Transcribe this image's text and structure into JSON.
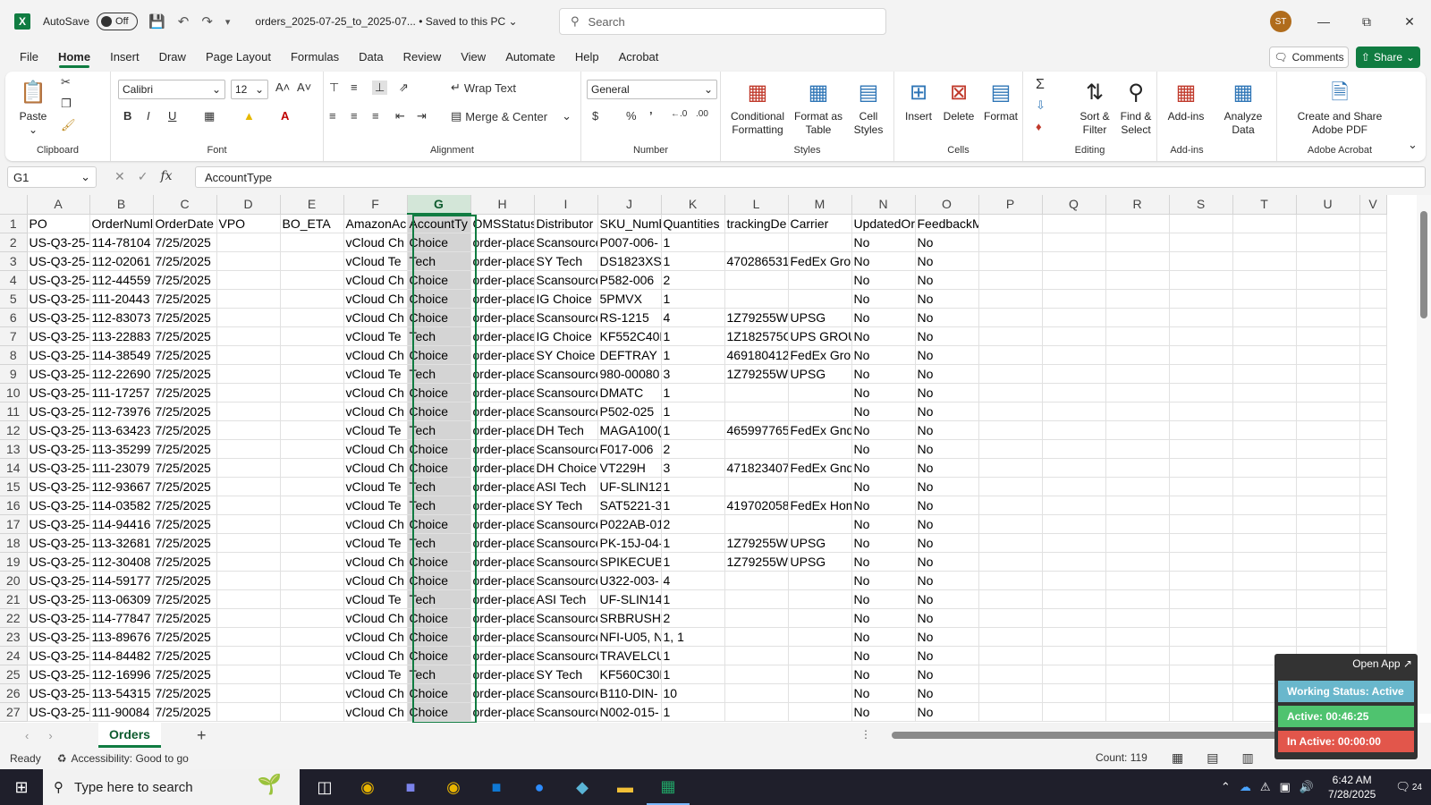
{
  "titlebar": {
    "autosave_label": "AutoSave",
    "autosave_state": "Off",
    "doc_name": "orders_2025-07-25_to_2025-07...",
    "save_state": "Saved to this PC",
    "search_placeholder": "Search",
    "user_initials": "ST"
  },
  "menu": {
    "tabs": [
      "File",
      "Home",
      "Insert",
      "Draw",
      "Page Layout",
      "Formulas",
      "Data",
      "Review",
      "View",
      "Automate",
      "Help",
      "Acrobat"
    ],
    "active": "Home",
    "comments": "Comments",
    "share": "Share"
  },
  "ribbon": {
    "clipboard": {
      "label": "Clipboard",
      "paste": "Paste"
    },
    "font": {
      "label": "Font",
      "font_name": "Calibri",
      "font_size": "12"
    },
    "alignment": {
      "label": "Alignment",
      "wrap": "Wrap Text",
      "merge": "Merge & Center"
    },
    "number": {
      "label": "Number",
      "format": "General"
    },
    "styles": {
      "label": "Styles",
      "cond1": "Conditional",
      "cond2": "Formatting",
      "fmt1": "Format as",
      "fmt2": "Table",
      "cell1": "Cell",
      "cell2": "Styles"
    },
    "cells": {
      "label": "Cells",
      "insert": "Insert",
      "delete": "Delete",
      "format": "Format"
    },
    "editing": {
      "label": "Editing",
      "sort1": "Sort &",
      "sort2": "Filter",
      "find1": "Find &",
      "find2": "Select"
    },
    "addins": {
      "label": "Add-ins",
      "addins": "Add-ins",
      "analyze1": "Analyze",
      "analyze2": "Data"
    },
    "acrobat": {
      "label": "Adobe Acrobat",
      "create1": "Create and Share",
      "create2": "Adobe PDF"
    }
  },
  "formula_bar": {
    "name_box": "G1",
    "formula": "AccountType"
  },
  "sheet": {
    "columns": [
      "A",
      "B",
      "C",
      "D",
      "E",
      "F",
      "G",
      "H",
      "I",
      "J",
      "K",
      "L",
      "M",
      "N",
      "O",
      "P",
      "Q",
      "R",
      "S",
      "T",
      "U",
      "V"
    ],
    "selected_column": "G",
    "rows": [
      [
        "PO",
        "OrderNuml",
        "OrderDate",
        "VPO",
        "BO_ETA",
        "AmazonAc",
        "AccountTy",
        "OMSStatus",
        "Distributor",
        "SKU_Numb",
        "Quantities",
        "trackingDe",
        "Carrier",
        "UpdatedOr",
        "FeedbackMessage"
      ],
      [
        "US-Q3-25-",
        "114-78104",
        "7/25/2025",
        "",
        "",
        "vCloud Ch",
        "Choice",
        "order-place",
        "Scansource",
        "P007-006-",
        "1",
        "",
        "",
        "No",
        "No"
      ],
      [
        "US-Q3-25-",
        "112-02061",
        "7/25/2025",
        "",
        "",
        "vCloud Te",
        "Tech",
        "order-place",
        "SY Tech",
        "DS1823XS+",
        "1",
        "470286531",
        "FedEx Grou",
        "No",
        "No"
      ],
      [
        "US-Q3-25-",
        "112-44559",
        "7/25/2025",
        "",
        "",
        "vCloud Ch",
        "Choice",
        "order-place",
        "Scansource",
        "P582-006",
        "2",
        "",
        "",
        "No",
        "No"
      ],
      [
        "US-Q3-25-",
        "111-20443",
        "7/25/2025",
        "",
        "",
        "vCloud Ch",
        "Choice",
        "order-place",
        "IG Choice",
        "5PMVX",
        "1",
        "",
        "",
        "No",
        "No"
      ],
      [
        "US-Q3-25-",
        "112-83073",
        "7/25/2025",
        "",
        "",
        "vCloud Ch",
        "Choice",
        "order-place",
        "Scansource",
        "RS-1215",
        "4",
        "1Z79255W",
        "UPSG",
        "No",
        "No"
      ],
      [
        "US-Q3-25-",
        "113-22883",
        "7/25/2025",
        "",
        "",
        "vCloud Te",
        "Tech",
        "order-place",
        "IG Choice",
        "KF552C40E",
        "1",
        "1Z182575C",
        "UPS GROU",
        "No",
        "No"
      ],
      [
        "US-Q3-25-",
        "114-38549",
        "7/25/2025",
        "",
        "",
        "vCloud Ch",
        "Choice",
        "order-place",
        "SY Choice",
        "DEFTRAY",
        "1",
        "469180412",
        "FedEx Grou",
        "No",
        "No"
      ],
      [
        "US-Q3-25-",
        "112-22690",
        "7/25/2025",
        "",
        "",
        "vCloud Te",
        "Tech",
        "order-place",
        "Scansource",
        "980-00080",
        "3",
        "1Z79255W",
        "UPSG",
        "No",
        "No"
      ],
      [
        "US-Q3-25-",
        "111-17257",
        "7/25/2025",
        "",
        "",
        "vCloud Ch",
        "Choice",
        "order-place",
        "Scansource",
        "DMATC",
        "1",
        "",
        "",
        "No",
        "No"
      ],
      [
        "US-Q3-25-",
        "112-73976",
        "7/25/2025",
        "",
        "",
        "vCloud Ch",
        "Choice",
        "order-place",
        "Scansource",
        "P502-025",
        "1",
        "",
        "",
        "No",
        "No"
      ],
      [
        "US-Q3-25-",
        "113-63423",
        "7/25/2025",
        "",
        "",
        "vCloud Te",
        "Tech",
        "order-place",
        "DH Tech",
        "MAGA100(",
        "1",
        "465997765",
        "FedEx Gnd",
        "No",
        "No"
      ],
      [
        "US-Q3-25-",
        "113-35299",
        "7/25/2025",
        "",
        "",
        "vCloud Ch",
        "Choice",
        "order-place",
        "Scansource",
        "F017-006",
        "2",
        "",
        "",
        "No",
        "No"
      ],
      [
        "US-Q3-25-",
        "111-23079",
        "7/25/2025",
        "",
        "",
        "vCloud Ch",
        "Choice",
        "order-place",
        "DH Choice",
        "VT229H",
        "3",
        "471823407",
        "FedEx Gnd",
        "No",
        "No"
      ],
      [
        "US-Q3-25-",
        "112-93667",
        "7/25/2025",
        "",
        "",
        "vCloud Te",
        "Tech",
        "order-place",
        "ASI Tech",
        "UF-SLIN12(",
        "1",
        "",
        "",
        "No",
        "No"
      ],
      [
        "US-Q3-25-",
        "114-03582",
        "7/25/2025",
        "",
        "",
        "vCloud Te",
        "Tech",
        "order-place",
        "SY Tech",
        "SAT5221-3",
        "1",
        "419702058",
        "FedEx Hom",
        "No",
        "No"
      ],
      [
        "US-Q3-25-",
        "114-94416",
        "7/25/2025",
        "",
        "",
        "vCloud Ch",
        "Choice",
        "order-place",
        "Scansource",
        "P022AB-01",
        "2",
        "",
        "",
        "No",
        "No"
      ],
      [
        "US-Q3-25-",
        "113-32681",
        "7/25/2025",
        "",
        "",
        "vCloud Te",
        "Tech",
        "order-place",
        "Scansource",
        "PK-15J-04-",
        "1",
        "1Z79255W",
        "UPSG",
        "No",
        "No"
      ],
      [
        "US-Q3-25-",
        "112-30408",
        "7/25/2025",
        "",
        "",
        "vCloud Ch",
        "Choice",
        "order-place",
        "Scansource",
        "SPIKECUBE",
        "1",
        "1Z79255W",
        "UPSG",
        "No",
        "No"
      ],
      [
        "US-Q3-25-",
        "114-59177",
        "7/25/2025",
        "",
        "",
        "vCloud Ch",
        "Choice",
        "order-place",
        "Scansource",
        "U322-003-",
        "4",
        "",
        "",
        "No",
        "No"
      ],
      [
        "US-Q3-25-",
        "113-06309",
        "7/25/2025",
        "",
        "",
        "vCloud Te",
        "Tech",
        "order-place",
        "ASI Tech",
        "UF-SLIN14(",
        "1",
        "",
        "",
        "No",
        "No"
      ],
      [
        "US-Q3-25-",
        "114-77847",
        "7/25/2025",
        "",
        "",
        "vCloud Ch",
        "Choice",
        "order-place",
        "Scansource",
        "SRBRUSHV",
        "2",
        "",
        "",
        "No",
        "No"
      ],
      [
        "US-Q3-25-",
        "113-89676",
        "7/25/2025",
        "",
        "",
        "vCloud Ch",
        "Choice",
        "order-place",
        "Scansource",
        "NFI-U05, N",
        "1, 1",
        "",
        "",
        "No",
        "No"
      ],
      [
        "US-Q3-25-",
        "114-84482",
        "7/25/2025",
        "",
        "",
        "vCloud Ch",
        "Choice",
        "order-place",
        "Scansource",
        "TRAVELCU",
        "1",
        "",
        "",
        "No",
        "No"
      ],
      [
        "US-Q3-25-",
        "112-16996",
        "7/25/2025",
        "",
        "",
        "vCloud Te",
        "Tech",
        "order-place",
        "SY Tech",
        "KF560C30E",
        "1",
        "",
        "",
        "No",
        "No"
      ],
      [
        "US-Q3-25-",
        "113-54315",
        "7/25/2025",
        "",
        "",
        "vCloud Ch",
        "Choice",
        "order-place",
        "Scansource",
        "B110-DIN-",
        "10",
        "",
        "",
        "No",
        "No"
      ],
      [
        "US-Q3-25-",
        "111-90084",
        "7/25/2025",
        "",
        "",
        "vCloud Ch",
        "Choice",
        "order-place",
        "Scansource",
        "N002-015-",
        "1",
        "",
        "",
        "No",
        "No"
      ]
    ]
  },
  "sheet_tabs": {
    "active": "Orders",
    "add": "+"
  },
  "status": {
    "ready": "Ready",
    "accessibility": "Accessibility: Good to go",
    "count": "Count: 119"
  },
  "tracker": {
    "open_app": "Open App ↗",
    "working": "Working Status: Active",
    "active": "Active: 00:46:25",
    "inactive": "In Active: 00:00:00"
  },
  "taskbar": {
    "search": "Type here to search",
    "time": "6:42 AM",
    "date": "7/28/2025",
    "notifications": "24"
  }
}
